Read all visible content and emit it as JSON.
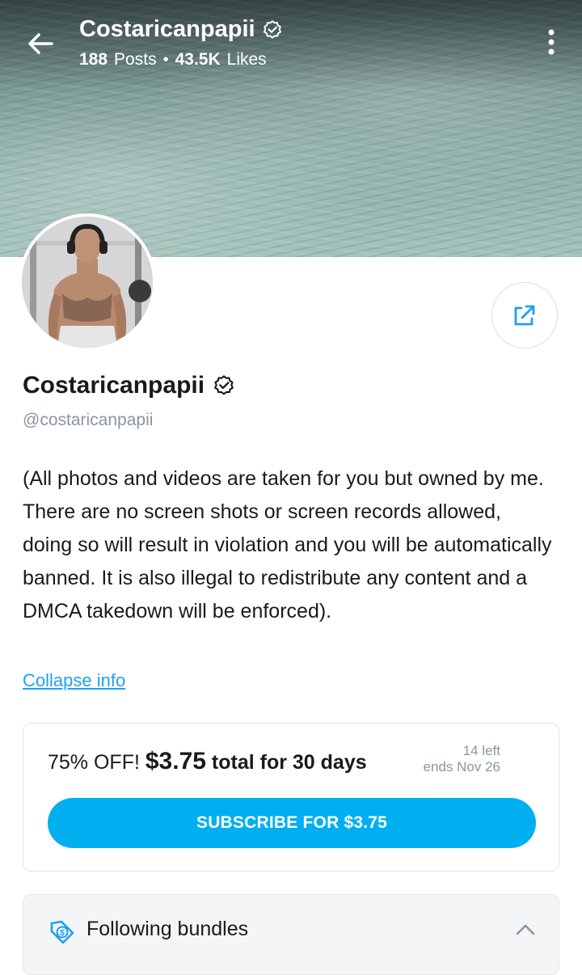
{
  "header": {
    "title": "Costaricanpapii",
    "posts_count": "188",
    "posts_label": "Posts",
    "separator": "•",
    "likes_count": "43.5K",
    "likes_label": "Likes"
  },
  "profile": {
    "name": "Costaricanpapii",
    "handle": "@costaricanpapii",
    "bio": "(All photos and videos are taken for you but owned by me. There are no screen shots or screen records allowed, doing so will result in violation and you will be automatically banned. It is also illegal to redistribute any content and a DMCA takedown will be enforced).",
    "collapse_label": "Collapse info"
  },
  "promo": {
    "discount": "75% OFF!",
    "price": "$3.75",
    "duration": "total for 30 days",
    "left": "14 left",
    "ends": "ends Nov 26",
    "subscribe_label": "SUBSCRIBE FOR $3.75"
  },
  "bundles": {
    "label": "Following bundles"
  },
  "icons": {
    "back": "arrow-left-icon",
    "menu": "more-vertical-icon",
    "verified": "verified-badge-icon",
    "share": "share-icon",
    "bundle": "price-tag-icon",
    "chevron": "chevron-up-icon"
  },
  "colors": {
    "accent": "#00aff0",
    "link": "#1da1f2",
    "muted": "#8a96a3"
  }
}
